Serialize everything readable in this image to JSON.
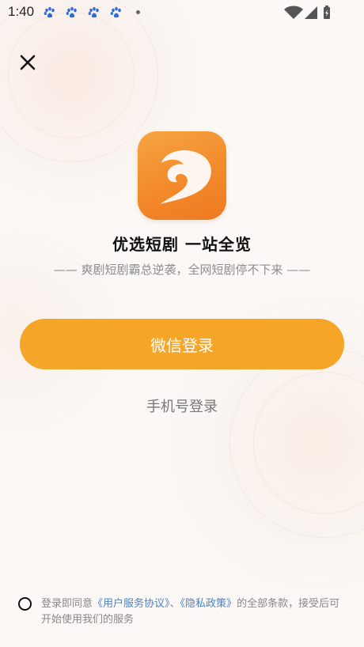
{
  "status_bar": {
    "time": "1:40",
    "notification_icons": [
      "baidu-paw-icon",
      "baidu-paw-icon",
      "baidu-paw-icon",
      "baidu-paw-icon"
    ],
    "system_icons": [
      "wifi-icon",
      "signal-icon",
      "battery-icon"
    ]
  },
  "header": {
    "close_icon": "close-icon"
  },
  "app": {
    "logo_icon": "app-logo-icon",
    "title": "优选短剧  一站全览",
    "subtitle": "—— 爽剧短剧霸总逆袭，全网短剧停不下来 ——"
  },
  "login": {
    "wechat_label": "微信登录",
    "phone_label": "手机号登录"
  },
  "agreement": {
    "prefix": "登录即同意",
    "user_agreement": "《用户服务协议》",
    "separator": "、",
    "privacy_policy": "《隐私政策》",
    "suffix": "的全部条款，接受后可开始使用我们的服务"
  },
  "colors": {
    "accent": "#f5a528",
    "logo_orange": "#f28a2a",
    "link": "#4b82c8",
    "subtitle_gray": "#8d8d8d"
  }
}
